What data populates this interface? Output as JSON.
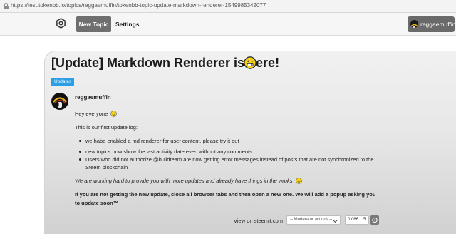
{
  "browser": {
    "url": "https://test.tokenbb.io/topics/reggaemuffin/tokenbb-topic-update-markdown-renderer-1549985342077"
  },
  "nav": {
    "new_topic": "New Topic",
    "settings": "Settings",
    "user": "reggaemuffin"
  },
  "post": {
    "title": "[Update] Markdown Renderer is here!",
    "tag": "Updates",
    "author": "reggaemuffin",
    "greeting": "Hey everyone",
    "intro": "This is our first update log:",
    "bullets": [
      "we habe enabled a md renderer for user content, please try it out",
      "new topics now show the last activity date even without any comments",
      "Users who did not authorize @buildteam are now getting error messages instead of posts that are not synchronized to the",
      "Steem blockchain"
    ],
    "working_line": "We are working hard to provide you with more updates and already have things in the wroks",
    "bold_line_1": "If you are not getting the new update, close all browser tabs and then open a new one. We will add a popup asking you",
    "bold_line_2": "to update soon™"
  },
  "footer": {
    "view_on_steemit": "View on steemit.com",
    "moderator_actions": "-- Moderator actions --",
    "vote_amount": "0.066",
    "vote_count": "5"
  }
}
